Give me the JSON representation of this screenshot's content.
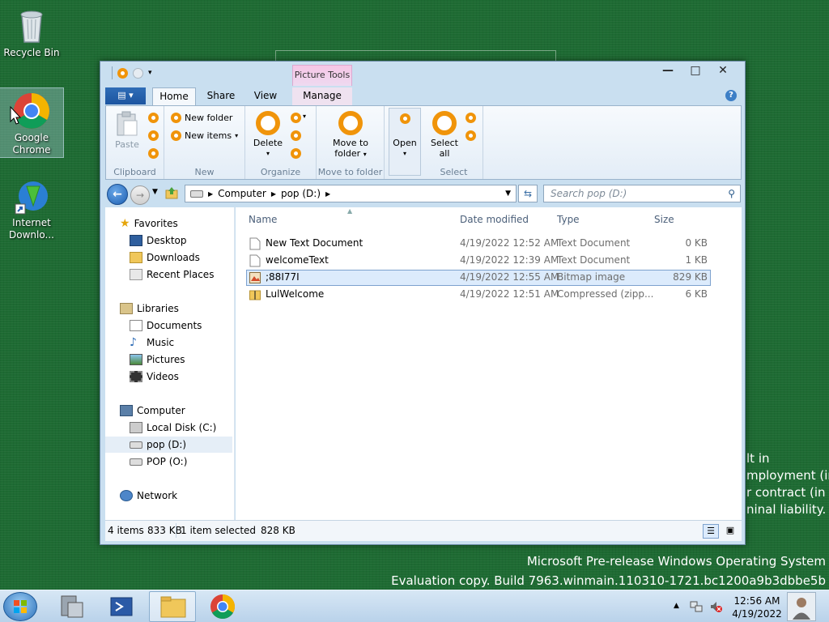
{
  "desktop": {
    "icons": [
      {
        "label": "Recycle Bin"
      },
      {
        "label": "Google Chrome"
      },
      {
        "label": "Internet Downlo..."
      }
    ],
    "side_text": [
      "lt in",
      "mployment (in",
      "r contract (in",
      "ninal liability."
    ],
    "watermark": {
      "line1": "Microsoft Pre-release Windows Operating System",
      "line2": "Evaluation copy. Build 7963.winmain.110310-1721.bc1200a9b3dbbe5b"
    }
  },
  "window": {
    "context_tab": "Picture Tools",
    "controls": {
      "minimize": "—",
      "maximize": "□",
      "close": "✕"
    },
    "ribbon_tabs": [
      "Home",
      "Share",
      "View",
      "Manage"
    ],
    "active_tab": "Home",
    "help": "?",
    "ribbon": {
      "clipboard": {
        "label": "Clipboard",
        "paste": "Paste"
      },
      "new": {
        "label": "New",
        "new_folder": "New folder",
        "new_items": "New items"
      },
      "organize": {
        "label": "Organize",
        "delete": "Delete"
      },
      "move": {
        "label": "Move to folder",
        "move_to": "Move to",
        "folder": "folder"
      },
      "open": {
        "open": "Open"
      },
      "select": {
        "label": "Select",
        "select": "Select",
        "all": "all"
      }
    },
    "address": {
      "segments": [
        "Computer",
        "pop (D:)"
      ]
    },
    "search": {
      "placeholder": "Search pop (D:)"
    },
    "nav": {
      "favorites": "Favorites",
      "desktop": "Desktop",
      "downloads": "Downloads",
      "recent": "Recent Places",
      "libraries": "Libraries",
      "documents": "Documents",
      "music": "Music",
      "pictures": "Pictures",
      "videos": "Videos",
      "computer": "Computer",
      "local_disk": "Local Disk (C:)",
      "pop_d": "pop (D:)",
      "pop_o": "POP (O:)",
      "network": "Network"
    },
    "columns": {
      "name": "Name",
      "date": "Date modified",
      "type": "Type",
      "size": "Size"
    },
    "files": [
      {
        "name": "New Text Document",
        "date": "4/19/2022 12:52 AM",
        "type": "Text Document",
        "size": "0 KB"
      },
      {
        "name": "welcomeText",
        "date": "4/19/2022 12:39 AM",
        "type": "Text Document",
        "size": "1 KB"
      },
      {
        "name": ";88I77I",
        "date": "4/19/2022 12:55 AM",
        "type": "Bitmap image",
        "size": "829 KB"
      },
      {
        "name": "LulWelcome",
        "date": "4/19/2022 12:51 AM",
        "type": "Compressed (zipp...",
        "size": "6 KB"
      }
    ],
    "status": {
      "count": "4 items",
      "total": "833 KB",
      "selected": "1 item selected",
      "selected_size": "828 KB"
    }
  },
  "taskbar": {
    "clock_time": "12:56 AM",
    "clock_date": "4/19/2022"
  }
}
